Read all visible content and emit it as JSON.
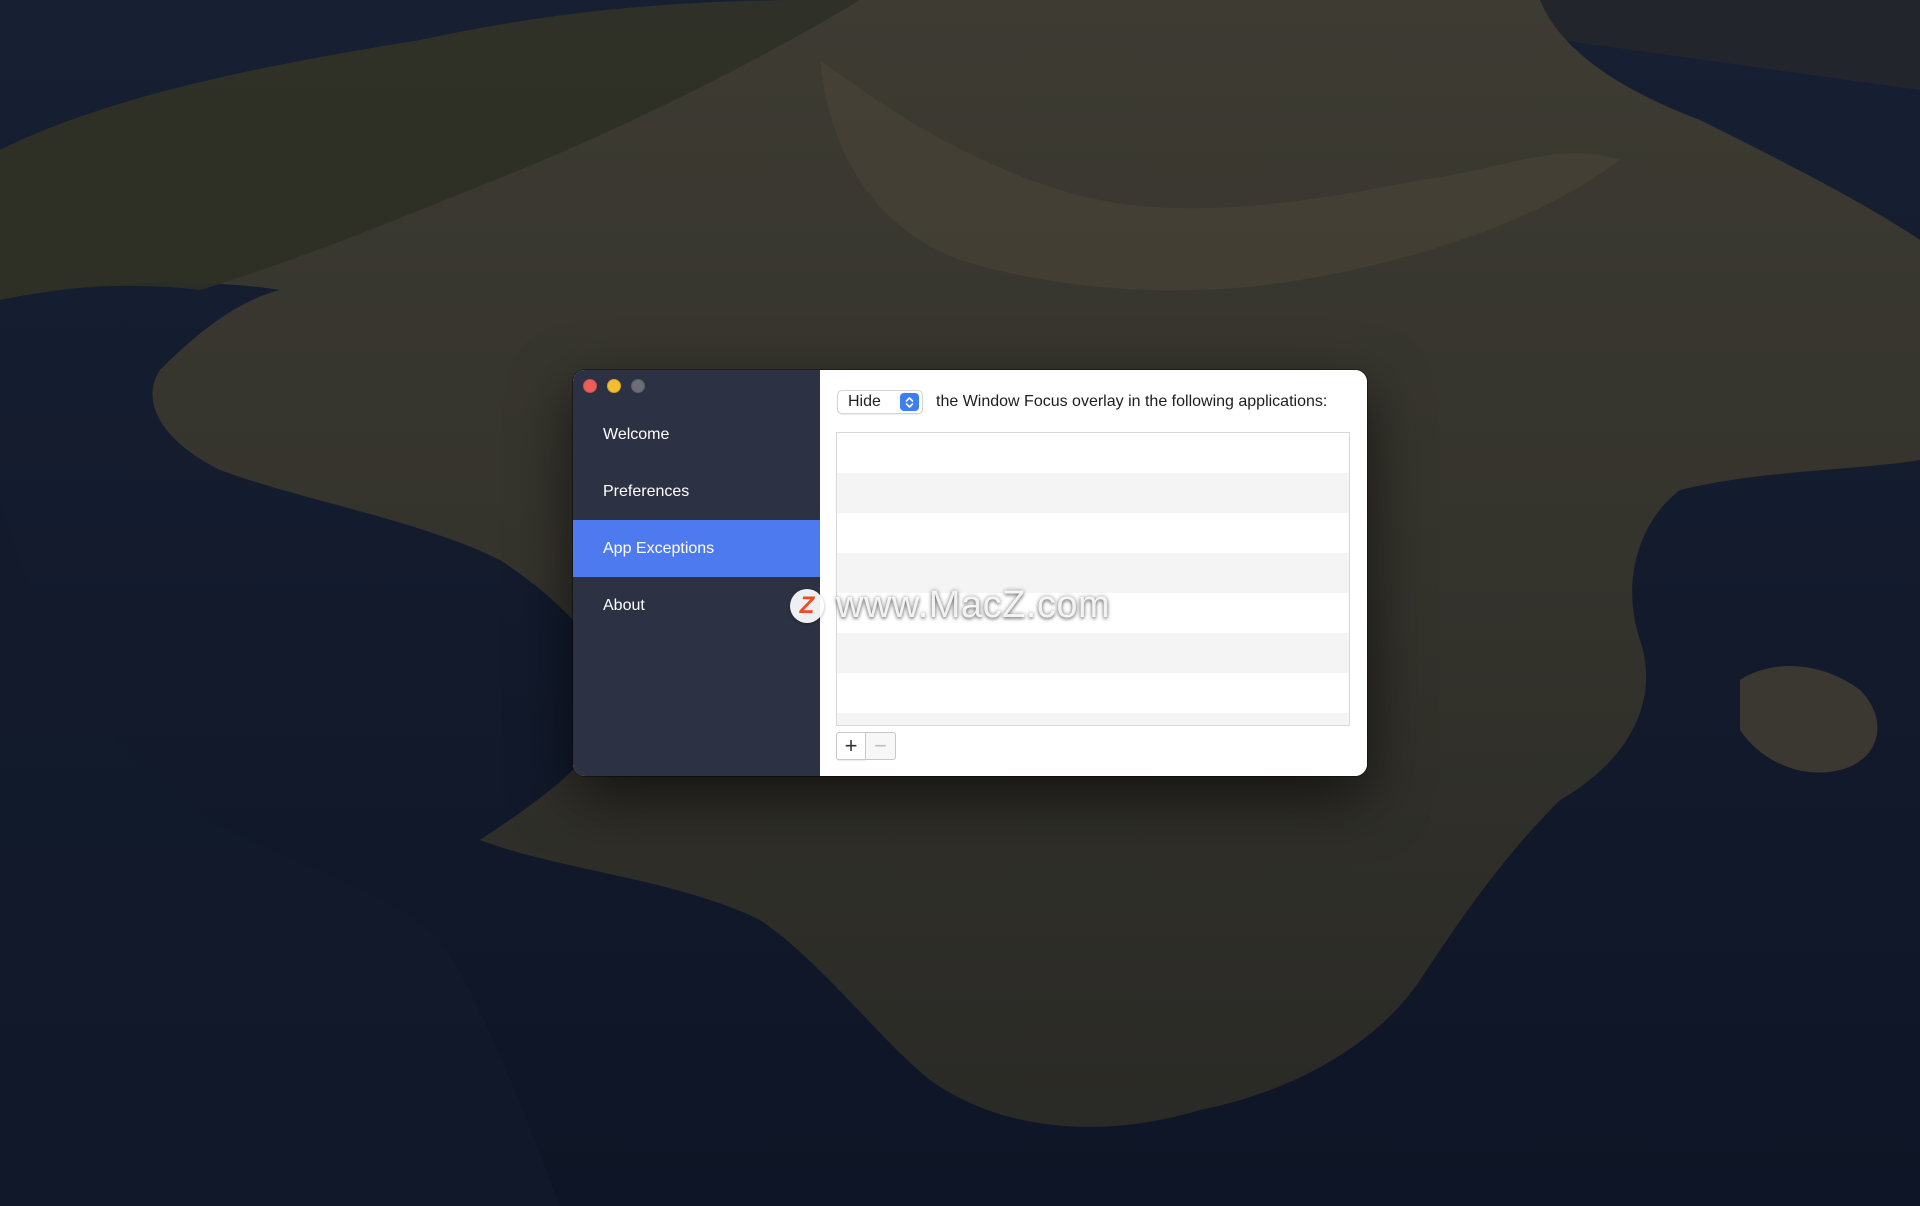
{
  "sidebar": {
    "items": [
      {
        "label": "Welcome",
        "active": false
      },
      {
        "label": "Preferences",
        "active": false
      },
      {
        "label": "App Exceptions",
        "active": true
      },
      {
        "label": "About",
        "active": false
      }
    ],
    "active_color": "#4e7af0",
    "background_color": "#2c3144"
  },
  "content": {
    "mode_select": {
      "selected": "Hide",
      "icon": "up-down-chevron-icon"
    },
    "description": "the Window Focus overlay in the following applications:",
    "list": {
      "rows": []
    },
    "buttons": {
      "add_label": "+",
      "remove_label": "−"
    }
  },
  "watermark": {
    "badge": "Z",
    "text": "www.MacZ.com"
  }
}
